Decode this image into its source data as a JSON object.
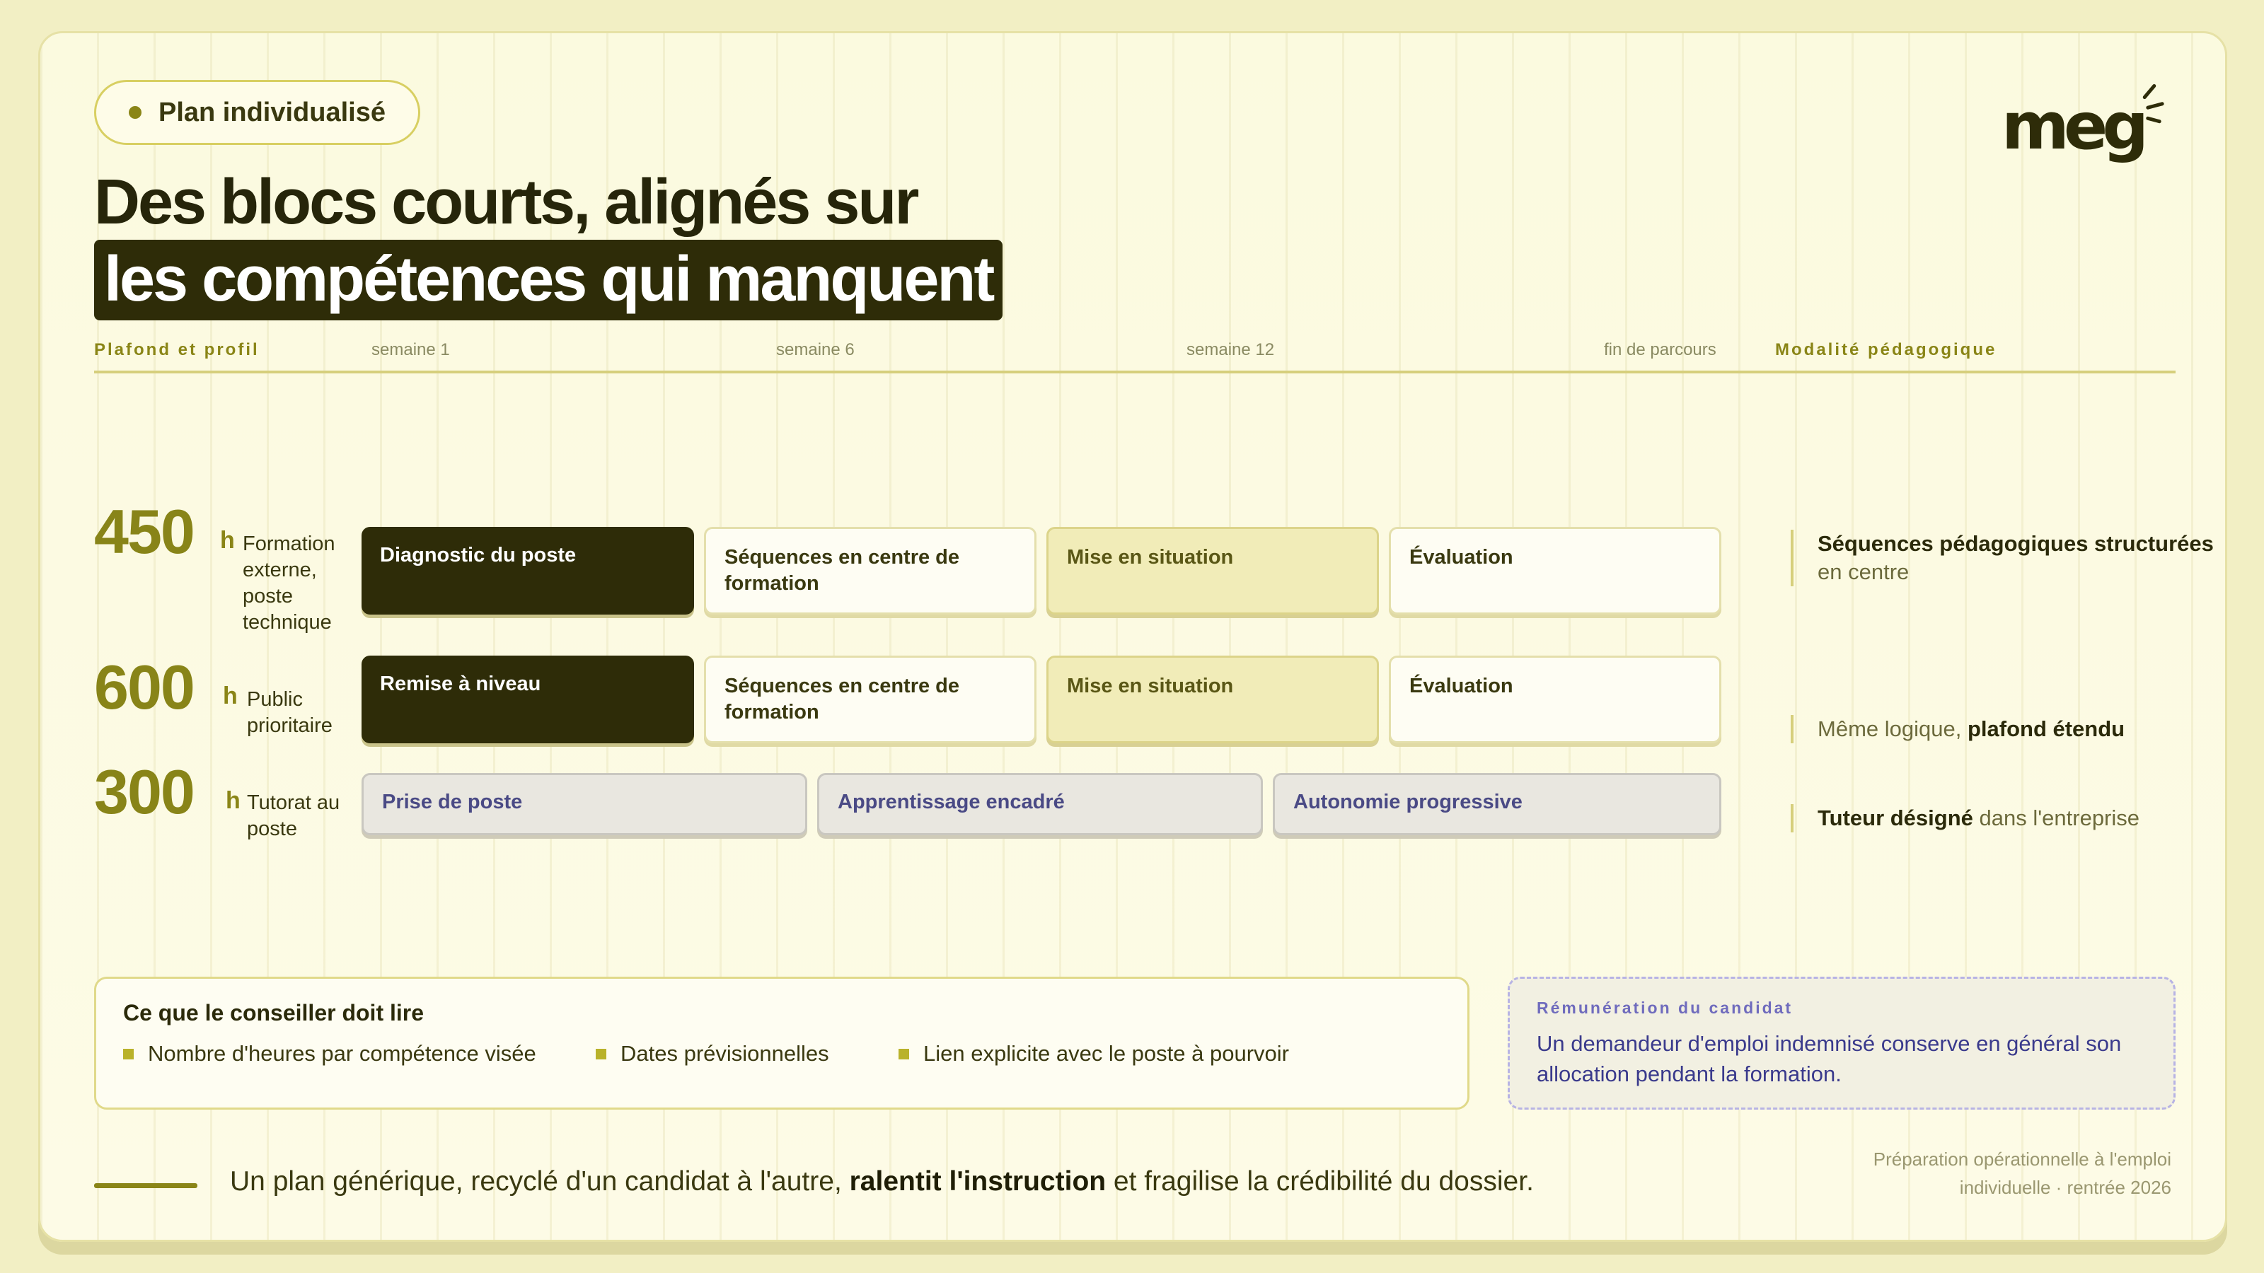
{
  "badge": {
    "label": "Plan individualisé"
  },
  "logo": {
    "text": "meg"
  },
  "title": {
    "line1": "Des blocs courts, alignés sur",
    "line2": "les compétences qui manquent"
  },
  "header": {
    "left": "Plafond et profil",
    "weeks": [
      "semaine 1",
      "semaine 6",
      "semaine 12",
      "fin de parcours"
    ],
    "right": "Modalité pédagogique"
  },
  "rows": [
    {
      "hours": "450",
      "unit": "h",
      "profile": "Formation externe, poste technique",
      "blocks": [
        "Diagnostic du poste",
        "Séquences en centre de formation",
        "Mise en situation",
        "Évaluation"
      ],
      "modality": {
        "strong": "Séquences pédagogiques structurées",
        "rest": " en centre"
      }
    },
    {
      "hours": "600",
      "unit": "h",
      "profile": "Public prioritaire",
      "blocks": [
        "Remise à niveau",
        "Séquences en centre de formation",
        "Mise en situation",
        "Évaluation"
      ],
      "modality": {
        "rest": "Même logique, ",
        "strong": "plafond étendu"
      }
    },
    {
      "hours": "300",
      "unit": "h",
      "profile": "Tutorat au poste",
      "blocks": [
        "Prise de poste",
        "Apprentissage encadré",
        "Autonomie progressive"
      ],
      "modality": {
        "strong": "Tuteur désigné",
        "rest": " dans l'entreprise"
      }
    }
  ],
  "advisor_box": {
    "title": "Ce que le conseiller doit lire",
    "items": [
      "Nombre d'heures par compétence visée",
      "Dates prévisionnelles",
      "Lien explicite avec le poste à pourvoir"
    ]
  },
  "remuneration_box": {
    "title": "Rémunération du candidat",
    "text": "Un demandeur d'emploi indemnisé conserve en général son allocation pendant la formation."
  },
  "footer": {
    "before": "Un plan générique, recyclé d'un candidat à l'autre, ",
    "strong": "ralentit l'instruction",
    "after": " et fragilise la crédibilité du dossier.",
    "meta_line1": "Préparation opérationnelle à l'emploi",
    "meta_line2": "individuelle · rentrée 2026"
  },
  "colors": {
    "accent": "#8a8517",
    "dark_block": "#2e2c08",
    "background": "#f2efc4",
    "tutor_text": "#4a4a85"
  }
}
